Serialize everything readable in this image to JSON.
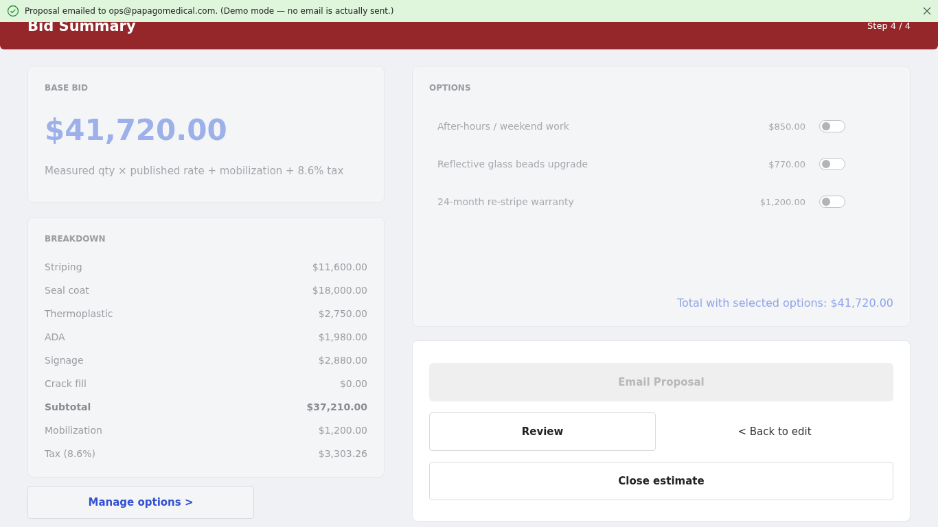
{
  "toast": {
    "message": "Proposal emailed to ops@papagomedical.com. (Demo mode — no email is actually sent.)"
  },
  "header": {
    "title": "Bid Summary",
    "step": "Step 4 / 4"
  },
  "base_bid": {
    "heading": "BASE BID",
    "amount": "$41,720.00",
    "note": "Measured qty × published rate + mobilization + 8.6% tax"
  },
  "breakdown": {
    "heading": "BREAKDOWN",
    "rows": [
      {
        "label": "Striping",
        "value": "$11,600.00",
        "emphasis": false
      },
      {
        "label": "Seal coat",
        "value": "$18,000.00",
        "emphasis": false
      },
      {
        "label": "Thermoplastic",
        "value": "$2,750.00",
        "emphasis": false
      },
      {
        "label": "ADA",
        "value": "$1,980.00",
        "emphasis": false
      },
      {
        "label": "Signage",
        "value": "$2,880.00",
        "emphasis": false
      },
      {
        "label": "Crack fill",
        "value": "$0.00",
        "emphasis": false
      },
      {
        "label": "Subtotal",
        "value": "$37,210.00",
        "emphasis": true
      },
      {
        "label": "Mobilization",
        "value": "$1,200.00",
        "emphasis": false
      },
      {
        "label": "Tax (8.6%)",
        "value": "$3,303.26",
        "emphasis": false
      }
    ]
  },
  "manage_button": "Manage options >",
  "options": {
    "heading": "OPTIONS",
    "items": [
      {
        "label": "After-hours / weekend work",
        "price": "$850.00",
        "on": false
      },
      {
        "label": "Reflective glass beads upgrade",
        "price": "$770.00",
        "on": false
      },
      {
        "label": "24-month re-stripe warranty",
        "price": "$1,200.00",
        "on": false
      }
    ],
    "total": "Total with selected options: $41,720.00"
  },
  "actions": {
    "email": {
      "label": "Email Proposal",
      "disabled": true
    },
    "review": "Review",
    "back": "< Back to edit",
    "close": "Close estimate"
  }
}
